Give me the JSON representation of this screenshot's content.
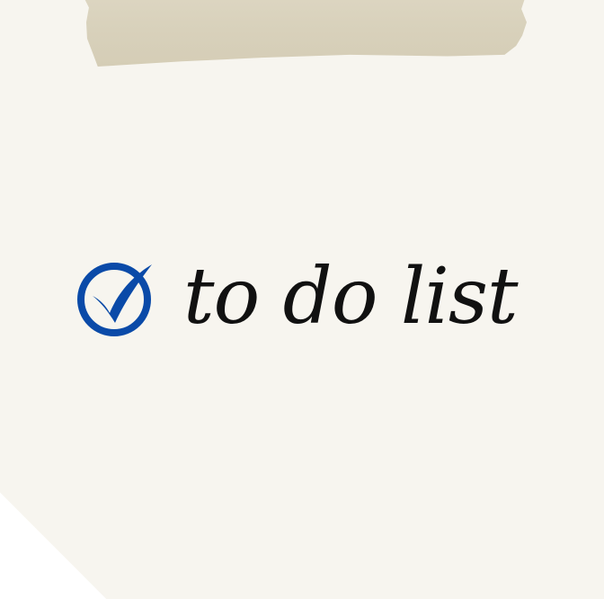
{
  "title": "to do list",
  "icon": "check-circle-icon",
  "colors": {
    "paper": "#f7f5ef",
    "tape": "#d8d1bb",
    "check": "#0a4aa8",
    "text": "#111111"
  }
}
